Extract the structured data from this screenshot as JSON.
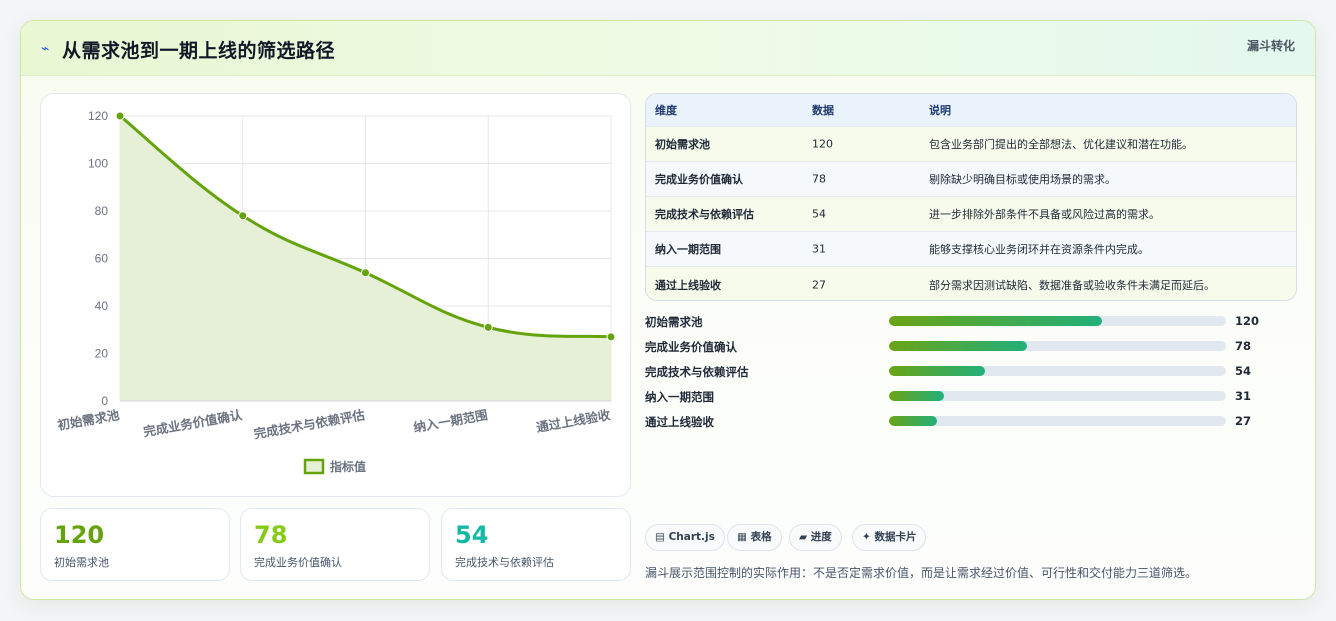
{
  "header": {
    "icon": "funnel-flow-icon",
    "title": "从需求池到一期上线的筛选路径",
    "tag": "漏斗转化"
  },
  "chart_data": {
    "type": "line",
    "categories": [
      "初始需求池",
      "完成业务价值确认",
      "完成技术与依赖评估",
      "纳入一期范围",
      "通过上线验收"
    ],
    "series": [
      {
        "name": "指标值",
        "values": [
          120,
          78,
          54,
          31,
          27
        ],
        "color": "#65a30d",
        "fill": "#e6f0d6"
      }
    ],
    "ylim": [
      0,
      120
    ],
    "yticks": [
      0,
      20,
      40,
      60,
      80,
      100,
      120
    ],
    "grid": true,
    "legend": "bottom",
    "title": "",
    "xlabel": "",
    "ylabel": ""
  },
  "stats": [
    {
      "value": "120",
      "label": "初始需求池",
      "color": "#65a30d"
    },
    {
      "value": "78",
      "label": "完成业务价值确认",
      "color": "#84cc16"
    },
    {
      "value": "54",
      "label": "完成技术与依赖评估",
      "color": "#14b8a6"
    }
  ],
  "table": {
    "headers": [
      "维度",
      "数据",
      "说明"
    ],
    "rows": [
      [
        "初始需求池",
        "120",
        "包含业务部门提出的全部想法、优化建议和潜在功能。"
      ],
      [
        "完成业务价值确认",
        "78",
        "剔除缺少明确目标或使用场景的需求。"
      ],
      [
        "完成技术与依赖评估",
        "54",
        "进一步排除外部条件不具备或风险过高的需求。"
      ],
      [
        "纳入一期范围",
        "31",
        "能够支撑核心业务闭环并在资源条件内完成。"
      ],
      [
        "通过上线验收",
        "27",
        "部分需求因测试缺陷、数据准备或验收条件未满足而延后。"
      ]
    ]
  },
  "progress": {
    "max": 190,
    "items": [
      {
        "label": "初始需求池",
        "value": 120
      },
      {
        "label": "完成业务价值确认",
        "value": 78
      },
      {
        "label": "完成技术与依赖评估",
        "value": 54
      },
      {
        "label": "纳入一期范围",
        "value": 31
      },
      {
        "label": "通过上线验收",
        "value": 27
      }
    ]
  },
  "chips": [
    {
      "icon": "chart-icon",
      "glyph": "▤",
      "label": "Chart.js"
    },
    {
      "icon": "table-icon",
      "glyph": "▦",
      "label": "表格"
    },
    {
      "icon": "progress-icon",
      "glyph": "▰",
      "label": "进度"
    },
    {
      "icon": "card-icon",
      "glyph": "✦",
      "label": "数据卡片"
    }
  ],
  "footnote": "漏斗展示范围控制的实际作用：不是否定需求价值，而是让需求经过价值、可行性和交付能力三道筛选。"
}
